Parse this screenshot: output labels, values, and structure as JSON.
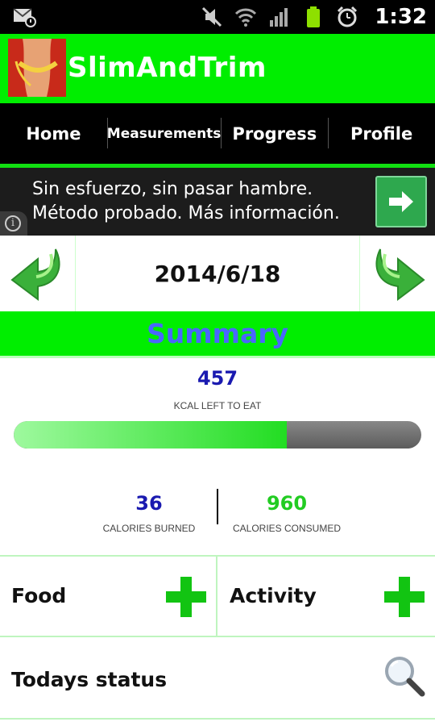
{
  "status_bar": {
    "time": "1:32",
    "icons": [
      "email-notification-icon",
      "mute-icon",
      "wifi-icon",
      "signal-icon",
      "battery-icon",
      "alarm-icon"
    ]
  },
  "app": {
    "title": "SlimAndTrim",
    "logo_icon": "waist-measuring-tape-logo",
    "accent_color": "#00ee00"
  },
  "tabs": [
    {
      "label": "Home"
    },
    {
      "label": "Measurements"
    },
    {
      "label": "Progress"
    },
    {
      "label": "Profile"
    }
  ],
  "ad": {
    "line1": "Sin esfuerzo, sin pasar hambre.",
    "line2": "Método probado. Más información.",
    "button_icon": "arrow-right-icon",
    "info_icon": "info-icon"
  },
  "date_nav": {
    "date": "2014/6/18",
    "prev_icon": "arrow-back-icon",
    "next_icon": "arrow-forward-icon"
  },
  "summary": {
    "title": "Summary",
    "kcal_left": "457",
    "kcal_left_label": "KCAL LEFT TO EAT",
    "progress_fraction": 0.67,
    "calories_burned": "36",
    "calories_burned_label": "CALORIES BURNED",
    "calories_consumed": "960",
    "calories_consumed_label": "CALORIES CONSUMED"
  },
  "entries": {
    "food_label": "Food",
    "activity_label": "Activity",
    "add_icon": "plus-icon"
  },
  "status": {
    "label": "Todays status",
    "icon": "magnifier-icon"
  }
}
